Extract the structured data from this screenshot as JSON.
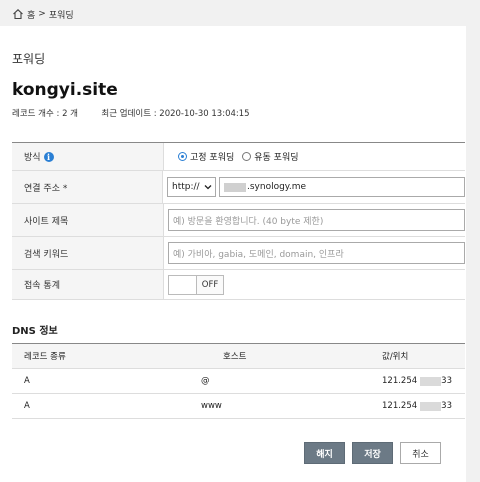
{
  "breadcrumb": {
    "home_label": "홈",
    "separator": ">",
    "current": "포워딩"
  },
  "page": {
    "title": "포워딩",
    "site_name": "kongyi.site"
  },
  "meta": {
    "record_count": "레코드 개수 : 2 개",
    "last_updated": "최근 업데이트 : 2020-10-30 13:04:15"
  },
  "form": {
    "method": {
      "label": "방식",
      "options": [
        {
          "label": "고정 포워딩",
          "selected": true
        },
        {
          "label": "유동 포워딩",
          "selected": false
        }
      ]
    },
    "connect": {
      "label": "연결 주소 *",
      "protocol": "http://",
      "host_value": ".synology.me"
    },
    "site_title": {
      "label": "사이트 제목",
      "placeholder": "예) 방문을 환영합니다. (40 byte 제한)"
    },
    "keywords": {
      "label": "검색 키워드",
      "placeholder": "예) 가비아, gabia, 도메인, domain, 인프라"
    },
    "stats": {
      "label": "접속 통계",
      "state": "OFF"
    }
  },
  "dns": {
    "title": "DNS 정보",
    "headers": [
      "레코드 종류",
      "호스트",
      "값/위치"
    ],
    "rows": [
      {
        "type": "A",
        "host": "@",
        "value": "121.254",
        "value_tail": "33"
      },
      {
        "type": "A",
        "host": "www",
        "value": "121.254",
        "value_tail": "33"
      }
    ]
  },
  "buttons": {
    "disable": "해지",
    "save": "저장",
    "cancel": "취소"
  },
  "colors": {
    "accent": "#2a7fd4",
    "button_dark": "#6c7a86"
  },
  "icons": [
    "home-icon",
    "info-icon",
    "chevron-down-icon"
  ]
}
